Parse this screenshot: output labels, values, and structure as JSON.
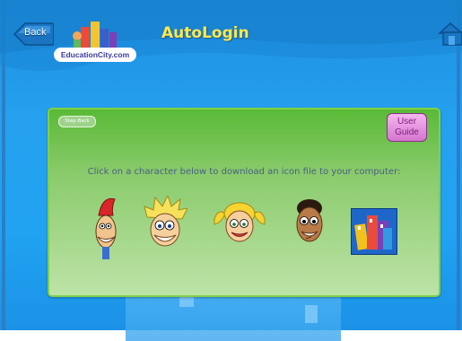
{
  "header": {
    "back_label": "Back",
    "logo_text": "EducationCity.com",
    "title": "AutoLogin"
  },
  "panel": {
    "step_back_label": "Step Back",
    "user_guide_label_line1": "User",
    "user_guide_label_line2": "Guide",
    "instruction": "Click on a character below to download an icon file to your computer:"
  },
  "characters": [
    {
      "icon": "character-red-hat-icon"
    },
    {
      "icon": "character-spiky-blond-icon"
    },
    {
      "icon": "character-pigtail-girl-icon"
    },
    {
      "icon": "character-dark-hair-boy-icon"
    },
    {
      "icon": "educationcity-buildings-icon"
    }
  ],
  "colors": {
    "background": "#21a3f2",
    "panel_green": "#5aba37",
    "title_yellow": "#ffe94a",
    "user_guide_pink": "#e58fdf"
  }
}
